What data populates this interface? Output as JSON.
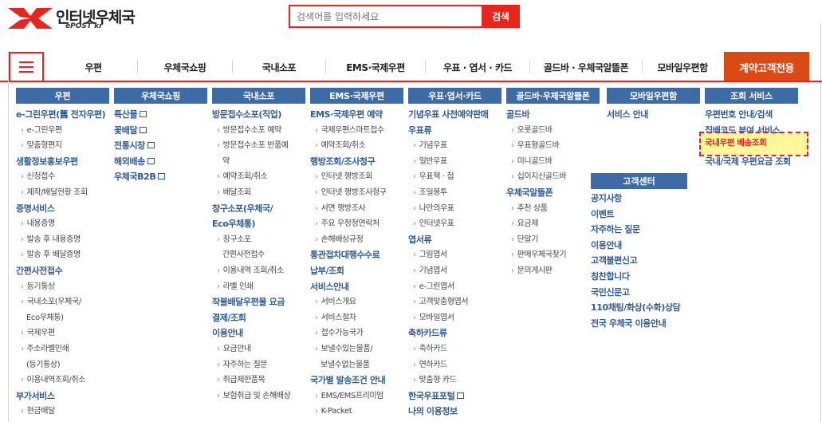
{
  "header": {
    "logo_title": "인터넷우체국",
    "logo_sub": "ePOST kr",
    "search_placeholder": "검색어를 입력하세요",
    "search_button": "검색"
  },
  "nav": {
    "items": [
      "우편",
      "우체국쇼핑",
      "국내소포",
      "EMS·국제우편",
      "우표 · 엽서 · 카드",
      "골드바 · 우체국알뜰폰",
      "모바일우편함"
    ],
    "cta": "계약고객전용"
  },
  "columns": [
    {
      "head": "우편",
      "entries": [
        {
          "t": "cat",
          "v": "e-그린우편(舊 전자우편)"
        },
        {
          "t": "sub",
          "v": "e-그린우편"
        },
        {
          "t": "sub",
          "v": "맞춤형편지"
        },
        {
          "t": "cat",
          "v": "생활정보홍보우편"
        },
        {
          "t": "sub",
          "v": "신청접수"
        },
        {
          "t": "sub",
          "v": "제작/배달현황 조회"
        },
        {
          "t": "cat",
          "v": "증명서비스"
        },
        {
          "t": "sub",
          "v": "내용증명"
        },
        {
          "t": "sub",
          "v": "발송 후 내용증명"
        },
        {
          "t": "sub",
          "v": "발송 후 배달증명"
        },
        {
          "t": "cat",
          "v": "간편사전접수"
        },
        {
          "t": "sub",
          "v": "등기통상"
        },
        {
          "t": "sub",
          "v": "국내소포(우체국/"
        },
        {
          "t": "cont",
          "v": "Eco우체통)"
        },
        {
          "t": "sub",
          "v": "국제우편"
        },
        {
          "t": "sub",
          "v": "주소라벨인쇄"
        },
        {
          "t": "cont",
          "v": "(등기통상)"
        },
        {
          "t": "sub",
          "v": "이용내역조회/취소"
        },
        {
          "t": "cat",
          "v": "부가서비스"
        },
        {
          "t": "sub",
          "v": "현금배달"
        }
      ]
    },
    {
      "head": "우체국쇼핑",
      "entries": [
        {
          "t": "catx",
          "v": "특산물"
        },
        {
          "t": "catx",
          "v": "꽃배달"
        },
        {
          "t": "catx",
          "v": "전통시장"
        },
        {
          "t": "catx",
          "v": "해외배송"
        },
        {
          "t": "catx",
          "v": "우체국B2B"
        }
      ]
    },
    {
      "head": "국내소포",
      "entries": [
        {
          "t": "cat",
          "v": "방문접수소포(직업)"
        },
        {
          "t": "sub",
          "v": "방문접수소포 예약"
        },
        {
          "t": "sub",
          "v": "방문접수소포 반품예"
        },
        {
          "t": "cont",
          "v": "약"
        },
        {
          "t": "sub",
          "v": "예약조회/취소"
        },
        {
          "t": "sub",
          "v": "배달조회"
        },
        {
          "t": "cat",
          "v": "창구소포(우체국/"
        },
        {
          "t": "cat",
          "v": "Eco우체통)"
        },
        {
          "t": "sub",
          "v": "창구소포"
        },
        {
          "t": "cont",
          "v": "간편사전접수"
        },
        {
          "t": "sub",
          "v": "이용내역 조회/취소"
        },
        {
          "t": "sub",
          "v": "라벨 인쇄"
        },
        {
          "t": "cat",
          "v": "착불배달우편물 요금"
        },
        {
          "t": "cat",
          "v": "결제/조회"
        },
        {
          "t": "cat",
          "v": "이용안내"
        },
        {
          "t": "sub",
          "v": "요금안내"
        },
        {
          "t": "sub",
          "v": "자주하는 질문"
        },
        {
          "t": "sub",
          "v": "취급제한품목"
        },
        {
          "t": "sub",
          "v": "보험취급 및 손해배상"
        }
      ]
    },
    {
      "head": "EMS·국제우편",
      "entries": [
        {
          "t": "cat",
          "v": "EMS·국제우편 예약"
        },
        {
          "t": "sub",
          "v": "국제우편스마트접수"
        },
        {
          "t": "sub",
          "v": "예약조회/취소"
        },
        {
          "t": "cat",
          "v": "행방조회/조사청구"
        },
        {
          "t": "sub",
          "v": "인터넷 행방조회"
        },
        {
          "t": "sub",
          "v": "인터넷 행방조사청구"
        },
        {
          "t": "sub",
          "v": "서면 행방조사"
        },
        {
          "t": "sub",
          "v": "주요 우정청연락처"
        },
        {
          "t": "sub",
          "v": "손해배상규정"
        },
        {
          "t": "cat",
          "v": "통관접차대행수수료"
        },
        {
          "t": "cat",
          "v": "납부/조회"
        },
        {
          "t": "cat",
          "v": "서비스안내"
        },
        {
          "t": "sub",
          "v": "서비스개요"
        },
        {
          "t": "sub",
          "v": "서비스절차"
        },
        {
          "t": "sub",
          "v": "접수가능국가"
        },
        {
          "t": "sub",
          "v": "보낼수있는물품/"
        },
        {
          "t": "cont",
          "v": "보낼수없는물품"
        },
        {
          "t": "cat",
          "v": "국가별 발송조건 안내"
        },
        {
          "t": "sub",
          "v": "EMS/EMS프리미엄"
        },
        {
          "t": "sub",
          "v": "K-Packet"
        }
      ]
    },
    {
      "head": "우표·엽서·카드",
      "entries": [
        {
          "t": "cat",
          "v": "기념우표 사전예약판매"
        },
        {
          "t": "cat",
          "v": "우표류"
        },
        {
          "t": "sub",
          "v": "기념우표"
        },
        {
          "t": "sub",
          "v": "일반우표"
        },
        {
          "t": "sub",
          "v": "우표책 · 첩"
        },
        {
          "t": "sub",
          "v": "조일봉투"
        },
        {
          "t": "sub",
          "v": "나만의우표"
        },
        {
          "t": "sub",
          "v": "인터넷우표"
        },
        {
          "t": "cat",
          "v": "엽서류"
        },
        {
          "t": "sub",
          "v": "그림엽서"
        },
        {
          "t": "sub",
          "v": "기념엽서"
        },
        {
          "t": "sub",
          "v": "e-그린엽서"
        },
        {
          "t": "sub",
          "v": "고객맞춤형엽서"
        },
        {
          "t": "sub",
          "v": "모바일엽서"
        },
        {
          "t": "cat",
          "v": "축하카드류"
        },
        {
          "t": "sub",
          "v": "축하카드"
        },
        {
          "t": "sub",
          "v": "연하카드"
        },
        {
          "t": "sub",
          "v": "맞춤형 카드"
        },
        {
          "t": "catx",
          "v": "한국우표포털"
        },
        {
          "t": "cat",
          "v": "나의 이용정보"
        }
      ]
    },
    {
      "head": "골드바·우체국알뜰폰",
      "entries": [
        {
          "t": "cat",
          "v": "골드바"
        },
        {
          "t": "sub",
          "v": "오롯골드바"
        },
        {
          "t": "sub",
          "v": "우표형골드바"
        },
        {
          "t": "sub",
          "v": "미니골드바"
        },
        {
          "t": "sub",
          "v": "십이지신골드바"
        },
        {
          "t": "cat",
          "v": "우체국알뜰폰"
        },
        {
          "t": "sub",
          "v": "추천 상품"
        },
        {
          "t": "sub",
          "v": "요금제"
        },
        {
          "t": "sub",
          "v": "단말기"
        },
        {
          "t": "sub",
          "v": "판매우체국찾기"
        },
        {
          "t": "sub",
          "v": "문의게시판"
        }
      ]
    },
    {
      "head": "모바일우편함",
      "entries": [
        {
          "t": "cat",
          "v": "서비스 안내"
        }
      ]
    },
    {
      "head": "조회 서비스",
      "entries": [
        {
          "t": "cat",
          "v": "우편번호 안내/검색"
        },
        {
          "t": "cat",
          "v": "집배코드 부여 서비스"
        },
        {
          "t": "cat",
          "v": " "
        },
        {
          "t": "cat",
          "v": "국내/국제 우편요금 조회"
        }
      ]
    }
  ],
  "customer_center": {
    "head": "고객센터",
    "items": [
      "공지사항",
      "이벤트",
      "자주하는 질문",
      "이용안내",
      "고객불편신고",
      "칭찬합니다",
      "국민신문고",
      "110채팅/화상(수화)상담",
      "전국 우체국 이용안내"
    ]
  },
  "highlight": {
    "label": "국내우편 배송조회"
  }
}
